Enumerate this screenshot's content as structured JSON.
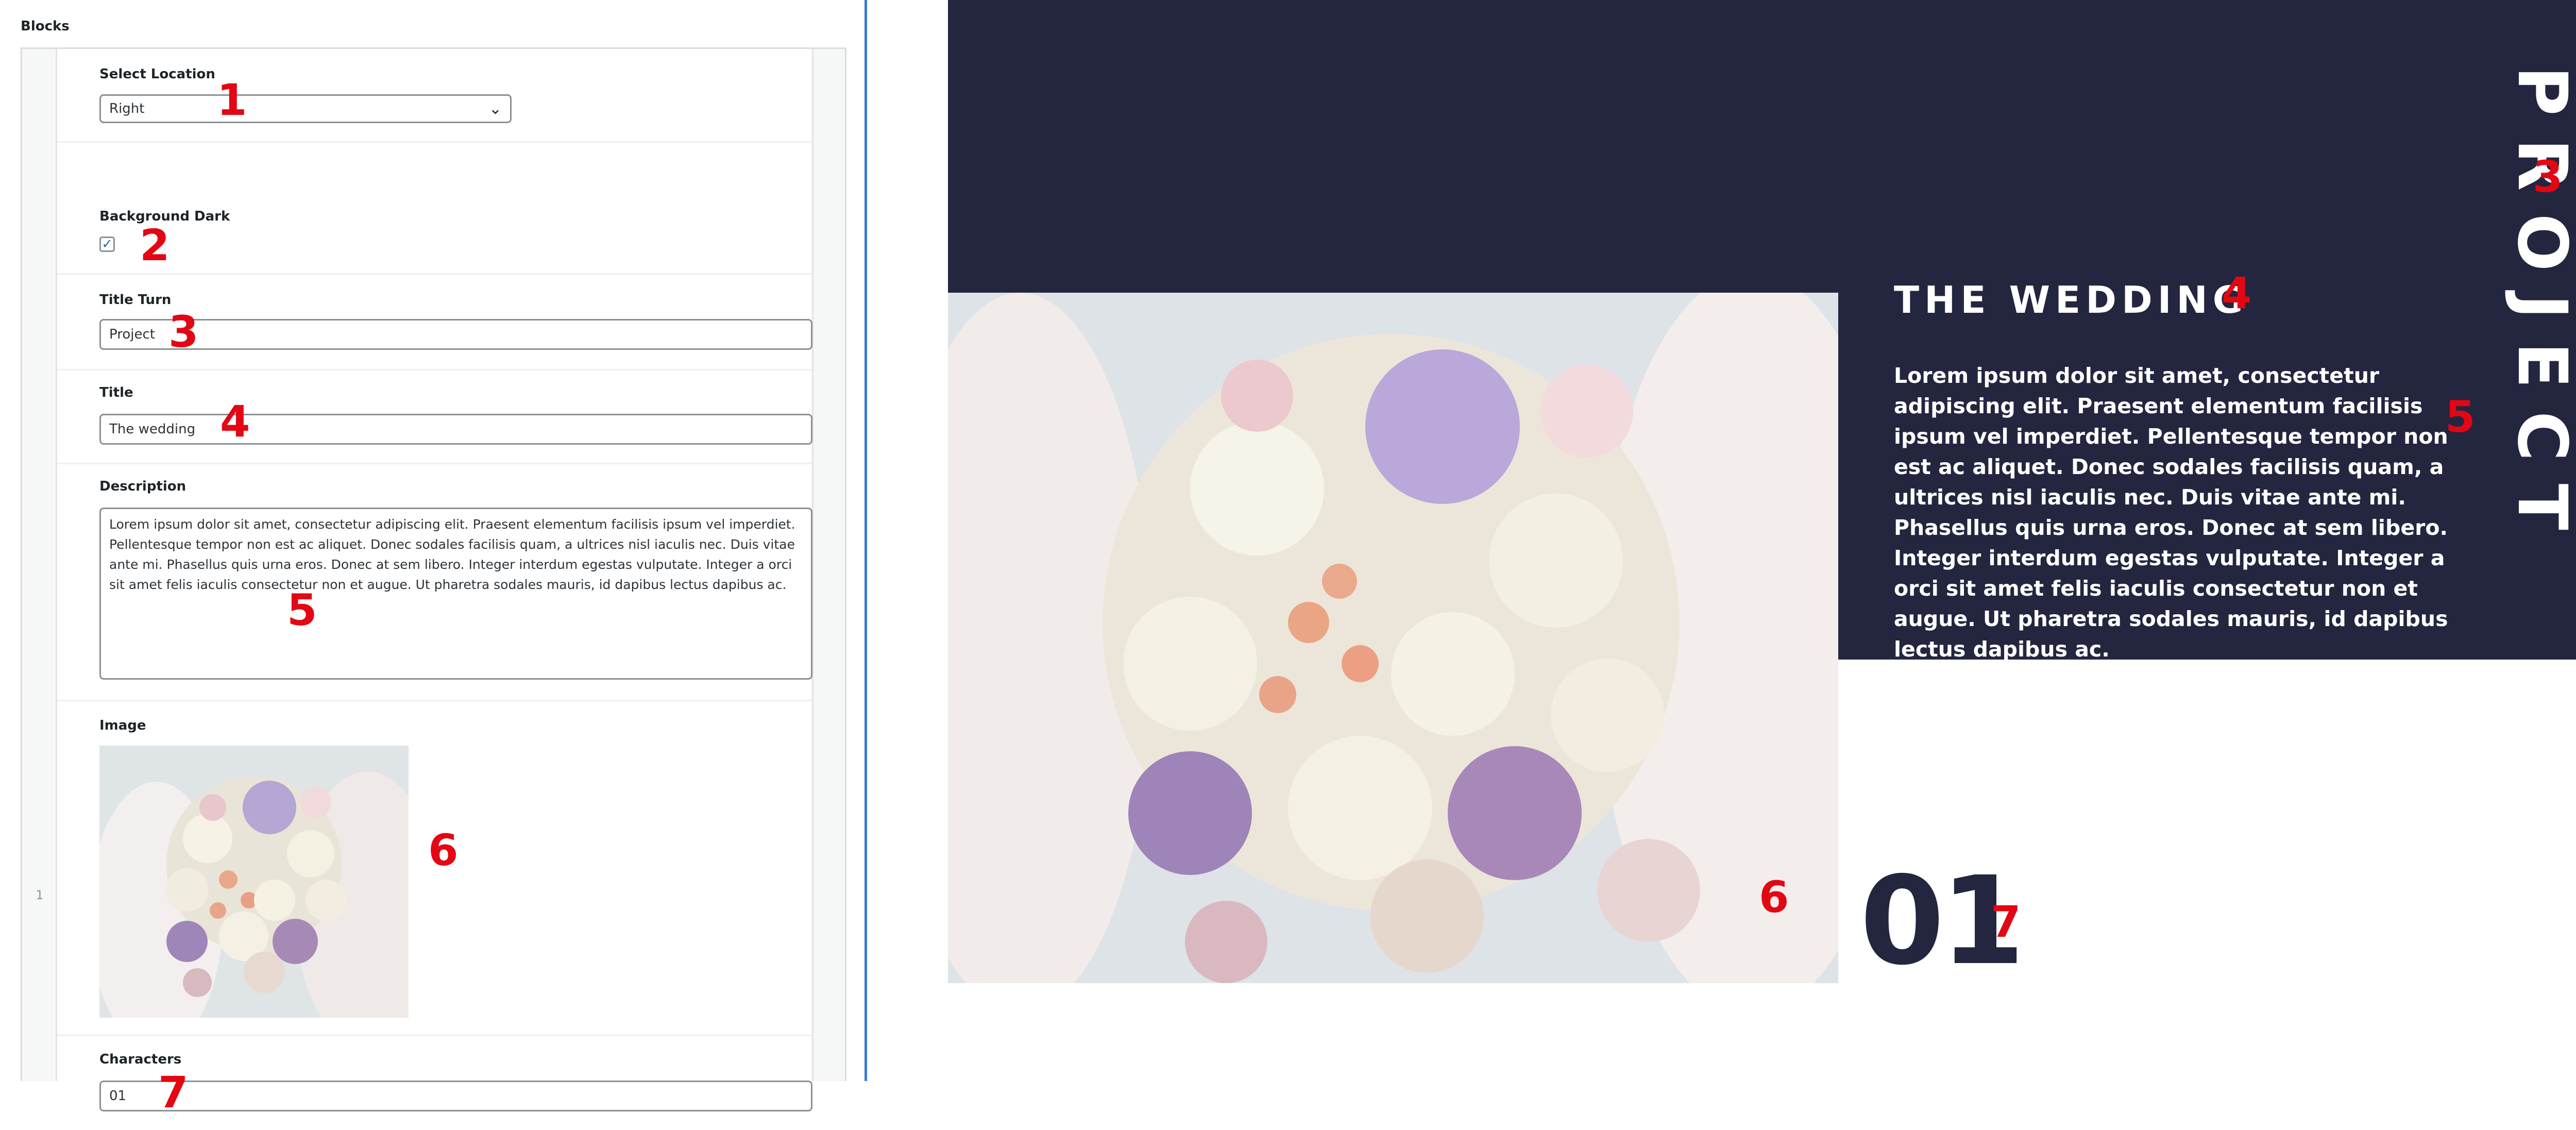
{
  "admin": {
    "panel_title": "Blocks",
    "row_number": "1",
    "fields": {
      "location": {
        "label": "Select Location",
        "value": "Right"
      },
      "background": {
        "label": "Background Dark",
        "checked": true
      },
      "title_turn": {
        "label": "Title Turn",
        "value": "Project"
      },
      "title": {
        "label": "Title",
        "value": "The wedding"
      },
      "description": {
        "label": "Description",
        "value": "Lorem ipsum dolor sit amet, consectetur adipiscing elit. Praesent elementum facilisis ipsum vel imperdiet. Pellentesque tempor non est ac aliquet. Donec sodales facilisis quam, a ultrices nisl iaculis nec. Duis vitae ante mi. Phasellus quis urna eros. Donec at sem libero. Integer interdum egestas vulputate. Integer a orci sit amet felis iaculis consectetur non et augue. Ut pharetra sodales mauris, id dapibus lectus dapibus ac."
      },
      "image": {
        "label": "Image"
      },
      "characters": {
        "label": "Characters",
        "value": "01"
      }
    }
  },
  "preview": {
    "title_turn": "PROJECT",
    "title": "THE WEDDING",
    "description": "Lorem ipsum dolor sit amet, consectetur adipiscing elit. Praesent elementum facilisis ipsum vel imperdiet. Pellentesque tempor non est ac aliquet. Donec sodales facilisis quam, a ultrices nisl iaculis nec. Duis vitae ante mi. Phasellus quis urna eros. Donec at sem libero. Integer interdum egestas vulputate. Integer a orci sit amet felis iaculis consectetur non et augue. Ut pharetra sodales mauris, id dapibus lectus dapibus ac.",
    "characters": "01"
  },
  "markers": {
    "admin": [
      "1",
      "2",
      "3",
      "4",
      "5",
      "6",
      "7"
    ],
    "preview": [
      "3",
      "4",
      "5",
      "6",
      "7"
    ]
  },
  "colors": {
    "dark_bg": "#242640",
    "marker": "#e30613",
    "accent_border": "#3a7bd5"
  },
  "icons": {
    "select_arrow": "chevron-down-icon",
    "checkbox": "checkmark-icon",
    "image": "bouquet-photo"
  }
}
